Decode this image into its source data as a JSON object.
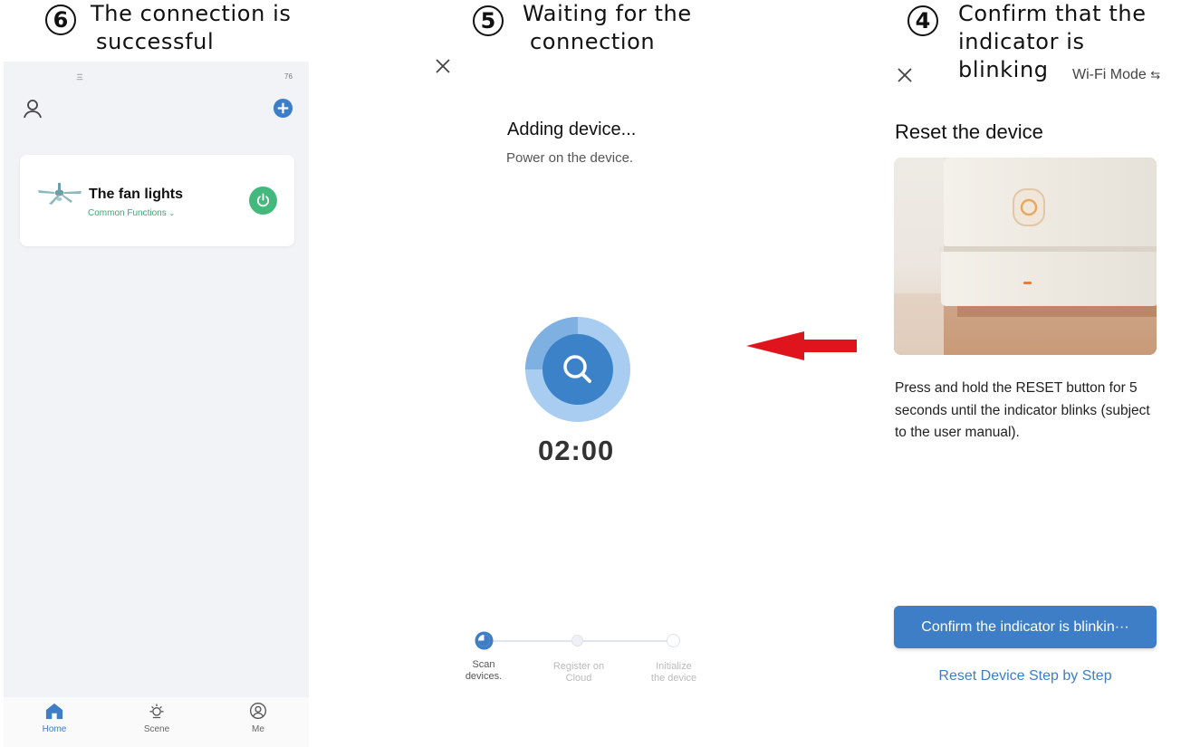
{
  "captions": {
    "step6": {
      "number": "6",
      "line1": "The connection is",
      "line2": "successful"
    },
    "step5": {
      "number": "5",
      "line1": "Waiting for the",
      "line2": "connection"
    },
    "step4": {
      "number": "4",
      "line1": "Confirm that the",
      "line2": "indicator is blinking"
    }
  },
  "home_screen": {
    "status_left": "三",
    "status_right": "76",
    "device": {
      "name": "The fan lights",
      "subtitle": "Common Functions",
      "icon": "ceiling-fan-icon"
    },
    "tabs": [
      {
        "label": "Home",
        "icon": "home-icon"
      },
      {
        "label": "Scene",
        "icon": "sun-icon"
      },
      {
        "label": "Me",
        "icon": "user-circle-icon"
      }
    ],
    "accent": "#3e7ec6",
    "power_color": "#43b97e"
  },
  "adding_screen": {
    "title": "Adding device...",
    "subtitle": "Power on the device.",
    "timer": "02:00",
    "steps": [
      {
        "line1": "Scan",
        "line2": "devices."
      },
      {
        "line1": "Register on",
        "line2": "Cloud"
      },
      {
        "line1": "Initialize",
        "line2": "the device"
      }
    ],
    "active_step": 1
  },
  "reset_screen": {
    "mode": "Wi-Fi Mode",
    "mode_icon": "swap-arrows-icon",
    "title": "Reset the device",
    "instructions": "Press and hold the RESET button for 5 seconds until the indicator blinks (subject to the user manual).",
    "confirm_button": "Confirm the indicator is blinkin···",
    "link": "Reset Device Step by Step"
  },
  "arrow_color": "#e0141c"
}
